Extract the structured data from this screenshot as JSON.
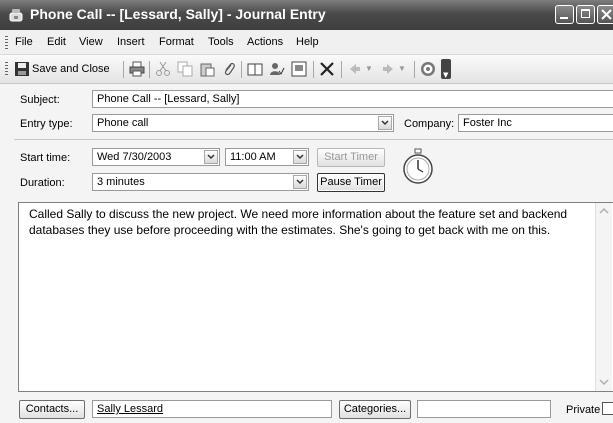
{
  "window": {
    "title": "Phone Call -- [Lessard, Sally] - Journal Entry"
  },
  "menu": [
    "File",
    "Edit",
    "View",
    "Insert",
    "Format",
    "Tools",
    "Actions",
    "Help"
  ],
  "toolbar": {
    "save_close_label": "Save and Close",
    "icons": [
      "save-icon",
      "print-icon",
      "cut-icon",
      "copy-icon",
      "paste-icon",
      "attach-icon",
      "address-book-icon",
      "check-names-icon",
      "insert-item-icon",
      "delete-icon",
      "previous-item-icon",
      "next-item-icon",
      "help-icon"
    ]
  },
  "form": {
    "subject_label": "Subject:",
    "subject_value": "Phone Call -- [Lessard, Sally]",
    "entry_type_label": "Entry type:",
    "entry_type_value": "Phone call",
    "company_label": "Company:",
    "company_value": "Foster Inc",
    "start_time_label": "Start time:",
    "start_date_value": "Wed 7/30/2003",
    "start_clock_value": "11:00 AM",
    "start_timer_label": "Start Timer",
    "duration_label": "Duration:",
    "duration_value": "3 minutes",
    "pause_timer_label": "Pause Timer"
  },
  "notes": {
    "text": "Called Sally to discuss the new project. We need more information about the feature set and backend databases they use before proceeding with the estimates. She's going to get back with me on this."
  },
  "footer": {
    "contacts_label": "Contacts...",
    "contacts_value": "Sally Lessard",
    "categories_label": "Categories...",
    "categories_value": "",
    "private_label": "Private"
  },
  "colors": {
    "titlebar": "#4a4a4a",
    "window_bg": "#f4f4f4",
    "field_border": "#9a9a9a"
  }
}
